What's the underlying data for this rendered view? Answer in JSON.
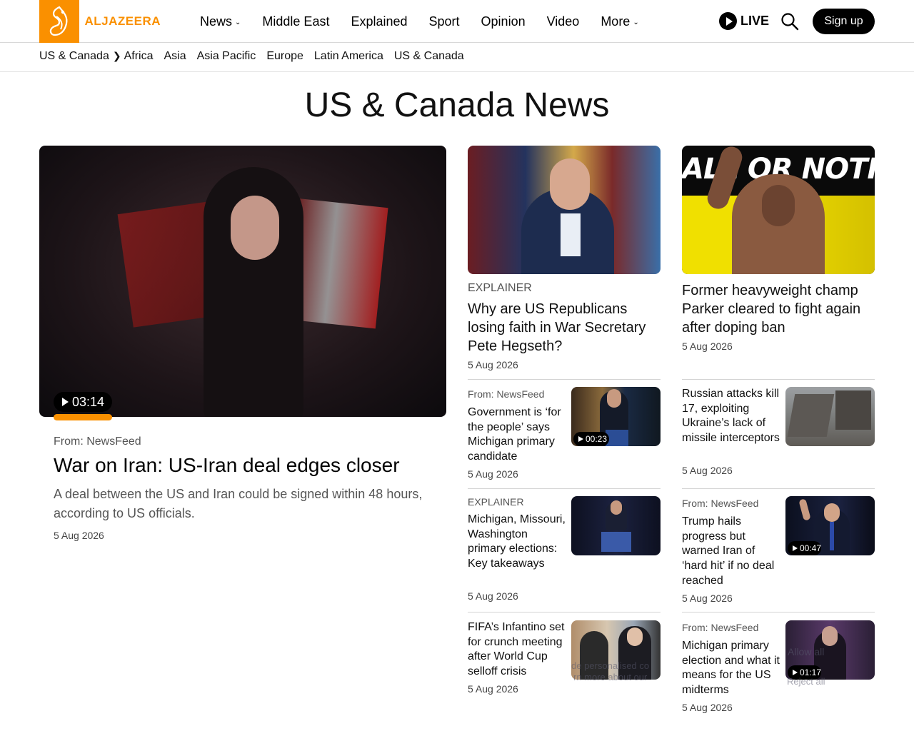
{
  "brand": {
    "logo_text": "ALJAZEERA",
    "accent": "#fa9000"
  },
  "nav": {
    "items": [
      {
        "label": "News",
        "dropdown": true
      },
      {
        "label": "Middle East",
        "dropdown": false
      },
      {
        "label": "Explained",
        "dropdown": false
      },
      {
        "label": "Sport",
        "dropdown": false
      },
      {
        "label": "Opinion",
        "dropdown": false
      },
      {
        "label": "Video",
        "dropdown": false
      },
      {
        "label": "More",
        "dropdown": true
      }
    ],
    "live_label": "LIVE",
    "signup_label": "Sign up"
  },
  "subnav": {
    "crumb": "US & Canada",
    "items": [
      "Africa",
      "Asia",
      "Asia Pacific",
      "Europe",
      "Latin America",
      "US & Canada"
    ]
  },
  "page": {
    "title": "US & Canada News"
  },
  "hero": {
    "duration": "03:14",
    "from": "From: NewsFeed",
    "title": "War on Iran: US-Iran deal edges closer",
    "description": "A deal between the US and Iran could be signed within 48 hours, according to US officials.",
    "date": "5 Aug 2026"
  },
  "col2": {
    "feature": {
      "kicker": "EXPLAINER",
      "title": "Why are US Republicans losing faith in War Secretary Pete Hegseth?",
      "date": "5 Aug 2026"
    },
    "items": [
      {
        "kicker": "From: NewsFeed",
        "title": "Government is ‘for the people’ says Michigan primary candidate",
        "date": "5 Aug 2026",
        "duration": "00:23"
      },
      {
        "kicker": "EXPLAINER",
        "title": "Michigan, Missouri, Washington primary elections: Key takeaways",
        "date": "5 Aug 2026"
      },
      {
        "kicker": "",
        "title": "FIFA’s Infantino set for crunch meeting after World Cup selloff crisis",
        "date": "5 Aug 2026"
      }
    ]
  },
  "col3": {
    "feature": {
      "image_text": "ALL OR NOTHING",
      "title": "Former heavyweight champ Parker cleared to fight again after doping ban",
      "date": "5 Aug 2026"
    },
    "items": [
      {
        "kicker": "",
        "title": "Russian attacks kill 17, exploiting Ukraine’s lack of missile interceptors",
        "date": "5 Aug 2026"
      },
      {
        "kicker": "From: NewsFeed",
        "title": "Trump hails progress but warned Iran of ‘hard hit’ if no deal reached",
        "date": "5 Aug 2026",
        "duration": "00:47"
      },
      {
        "kicker": "From: NewsFeed",
        "title": "Michigan primary election and what it means for the US midterms",
        "date": "5 Aug 2026",
        "duration": "01:17"
      }
    ]
  },
  "cookie_banner": {
    "text_1": "de personalised co",
    "text_2": "rn more about our",
    "allow_label": "Allow all",
    "reject_label": "Reject all"
  }
}
